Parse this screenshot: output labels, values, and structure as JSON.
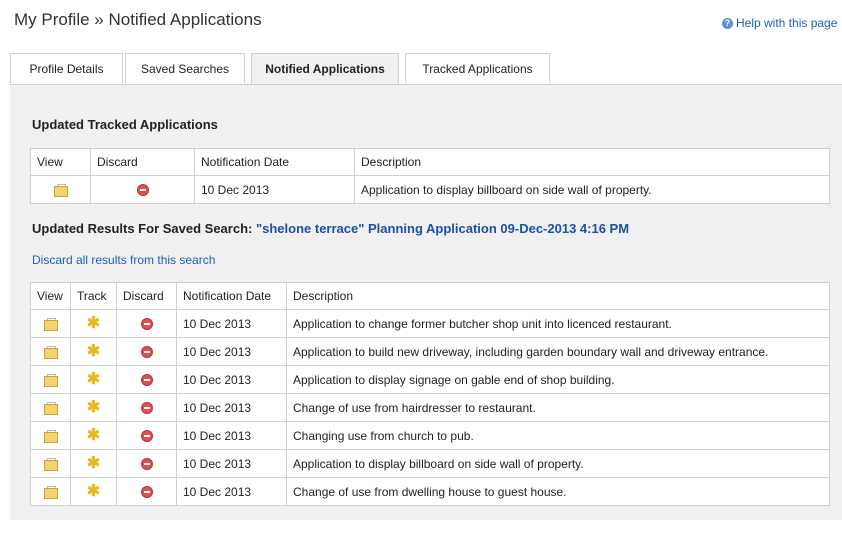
{
  "page": {
    "title": "My Profile » Notified Applications",
    "help_label": "Help with this page"
  },
  "tabs": [
    {
      "label": "Profile Details"
    },
    {
      "label": "Saved Searches"
    },
    {
      "label": "Notified Applications",
      "active": true
    },
    {
      "label": "Tracked Applications"
    }
  ],
  "tracked": {
    "title": "Updated Tracked Applications",
    "headers": [
      "View",
      "Discard",
      "Notification Date",
      "Description"
    ],
    "rows": [
      {
        "date": "10 Dec 2013",
        "description": "Application to display billboard on side wall of property."
      }
    ]
  },
  "saved": {
    "title_prefix": "Updated Results For Saved Search:",
    "query": "\"shelone terrace\" Planning Application 09-Dec-2013 4:16 PM",
    "discard_all": "Discard all results from this search",
    "headers": [
      "View",
      "Track",
      "Discard",
      "Notification Date",
      "Description"
    ],
    "rows": [
      {
        "date": "10 Dec 2013",
        "description": "Application to change former butcher shop unit into licenced restaurant."
      },
      {
        "date": "10 Dec 2013",
        "description": "Application to build new driveway, including garden boundary wall and driveway entrance."
      },
      {
        "date": "10 Dec 2013",
        "description": "Application to display signage on gable end of shop building."
      },
      {
        "date": "10 Dec 2013",
        "description": "Change of use from hairdresser to restaurant."
      },
      {
        "date": "10 Dec 2013",
        "description": "Changing use from church to pub."
      },
      {
        "date": "10 Dec 2013",
        "description": "Application to display billboard on side wall of property."
      },
      {
        "date": "10 Dec 2013",
        "description": "Change of use from dwelling house to guest house."
      }
    ]
  },
  "icons": {
    "view": "folder-document-icon",
    "track": "star-track-icon",
    "discard": "minus-circle-icon",
    "help": "question-circle-icon"
  },
  "colors": {
    "link": "#1d5fb8",
    "query": "#1d4fa8",
    "discard": "#e05050",
    "track": "#e8b81e",
    "panel_bg": "#f0f0f0"
  }
}
